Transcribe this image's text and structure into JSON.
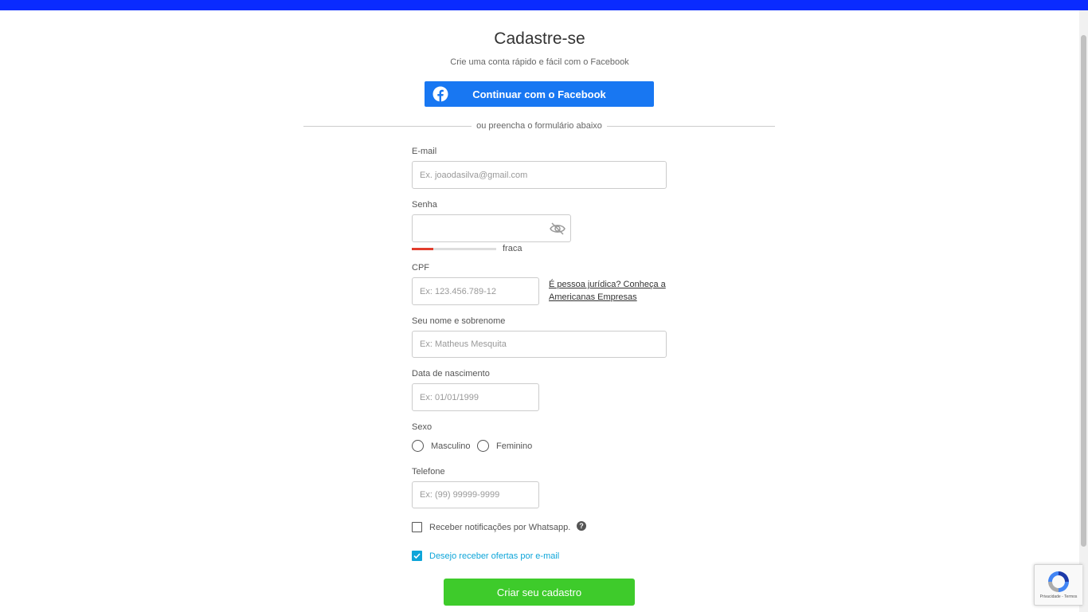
{
  "colors": {
    "brand": "#0a2bff",
    "facebook": "#1877f2",
    "submit": "#3ecb2b",
    "checked": "#0ea5d9",
    "weak": "#e23d2c"
  },
  "header": {
    "title": "Cadastre-se",
    "subtitle": "Crie uma conta rápido e fácil com o Facebook",
    "facebook_button": "Continuar com o Facebook",
    "divider_text": "ou preencha o formulário abaixo"
  },
  "form": {
    "email": {
      "label": "E-mail",
      "placeholder": "Ex. joaodasilva@gmail.com",
      "value": ""
    },
    "password": {
      "label": "Senha",
      "value": "",
      "strength_label": "fraca",
      "strength_level": 0.25,
      "toggle_icon": "eye-slash-icon"
    },
    "cpf": {
      "label": "CPF",
      "placeholder": "Ex: 123.456.789-12",
      "value": "",
      "business_link": "É pessoa jurídica? Conheça a Americanas Empresas"
    },
    "name": {
      "label": "Seu nome e sobrenome",
      "placeholder": "Ex: Matheus Mesquita",
      "value": ""
    },
    "birthdate": {
      "label": "Data de nascimento",
      "placeholder": "Ex: 01/01/1999",
      "value": ""
    },
    "gender": {
      "label": "Sexo",
      "options": [
        "Masculino",
        "Feminino"
      ],
      "selected": null
    },
    "phone": {
      "label": "Telefone",
      "placeholder": "Ex: (99) 99999-9999",
      "value": ""
    },
    "whatsapp": {
      "label": "Receber notificações por Whatsapp.",
      "checked": false,
      "help_icon": "?"
    },
    "email_offers": {
      "label": "Desejo receber ofertas por e-mail",
      "checked": true
    },
    "submit_label": "Criar seu cadastro"
  },
  "recaptcha": {
    "text": "Privacidade - Termos"
  }
}
